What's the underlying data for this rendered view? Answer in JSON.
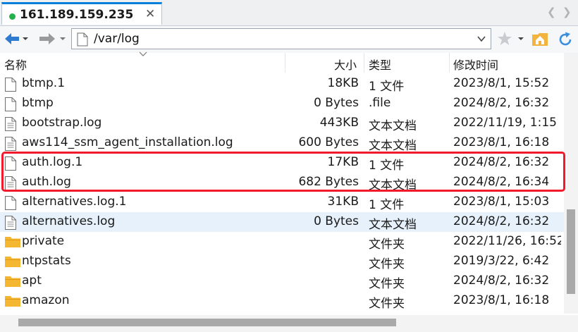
{
  "tab": {
    "title": "161.189.159.235",
    "status_color": "#22b14c"
  },
  "address": {
    "path": "/var/log"
  },
  "columns": {
    "name": "名称",
    "size": "大小",
    "type": "类型",
    "modified": "修改时间"
  },
  "files": [
    {
      "name": "btmp.1",
      "size": "18KB",
      "type": "1 文件",
      "modified": "2023/8/1, 15:52",
      "icon": "file-icon"
    },
    {
      "name": "btmp",
      "size": "0 Bytes",
      "type": ".file",
      "modified": "2024/8/2, 16:32",
      "icon": "file-icon"
    },
    {
      "name": "bootstrap.log",
      "size": "443KB",
      "type": "文本文档",
      "modified": "2022/11/19, 1:15",
      "icon": "text-file-icon"
    },
    {
      "name": "aws114_ssm_agent_installation.log",
      "size": "600 Bytes",
      "type": "文本文档",
      "modified": "2023/8/1, 16:18",
      "icon": "text-file-icon"
    },
    {
      "name": "auth.log.1",
      "size": "17KB",
      "type": "1 文件",
      "modified": "2024/8/2, 16:32",
      "icon": "file-icon"
    },
    {
      "name": "auth.log",
      "size": "682 Bytes",
      "type": "文本文档",
      "modified": "2024/8/2, 16:34",
      "icon": "text-file-icon"
    },
    {
      "name": "alternatives.log.1",
      "size": "31KB",
      "type": "1 文件",
      "modified": "2023/8/1, 15:03",
      "icon": "file-icon"
    },
    {
      "name": "alternatives.log",
      "size": "0 Bytes",
      "type": "文本文档",
      "modified": "2024/8/2, 16:32",
      "icon": "text-file-icon"
    },
    {
      "name": "private",
      "size": "",
      "type": "文件夹",
      "modified": "2022/11/26, 16:52",
      "icon": "folder-icon"
    },
    {
      "name": "ntpstats",
      "size": "",
      "type": "文件夹",
      "modified": "2019/3/22, 6:42",
      "icon": "folder-icon"
    },
    {
      "name": "apt",
      "size": "",
      "type": "文件夹",
      "modified": "2024/8/2, 16:32",
      "icon": "folder-icon"
    },
    {
      "name": "amazon",
      "size": "",
      "type": "文件夹",
      "modified": "2023/8/1, 16:18",
      "icon": "folder-icon"
    }
  ],
  "selected_row": 7,
  "highlighted_rows": [
    4,
    5
  ],
  "colors": {
    "highlight_border": "#f01a2c",
    "selection": "#e6f1fb",
    "accent": "#0a7fd9",
    "folder": "#f5b731"
  }
}
